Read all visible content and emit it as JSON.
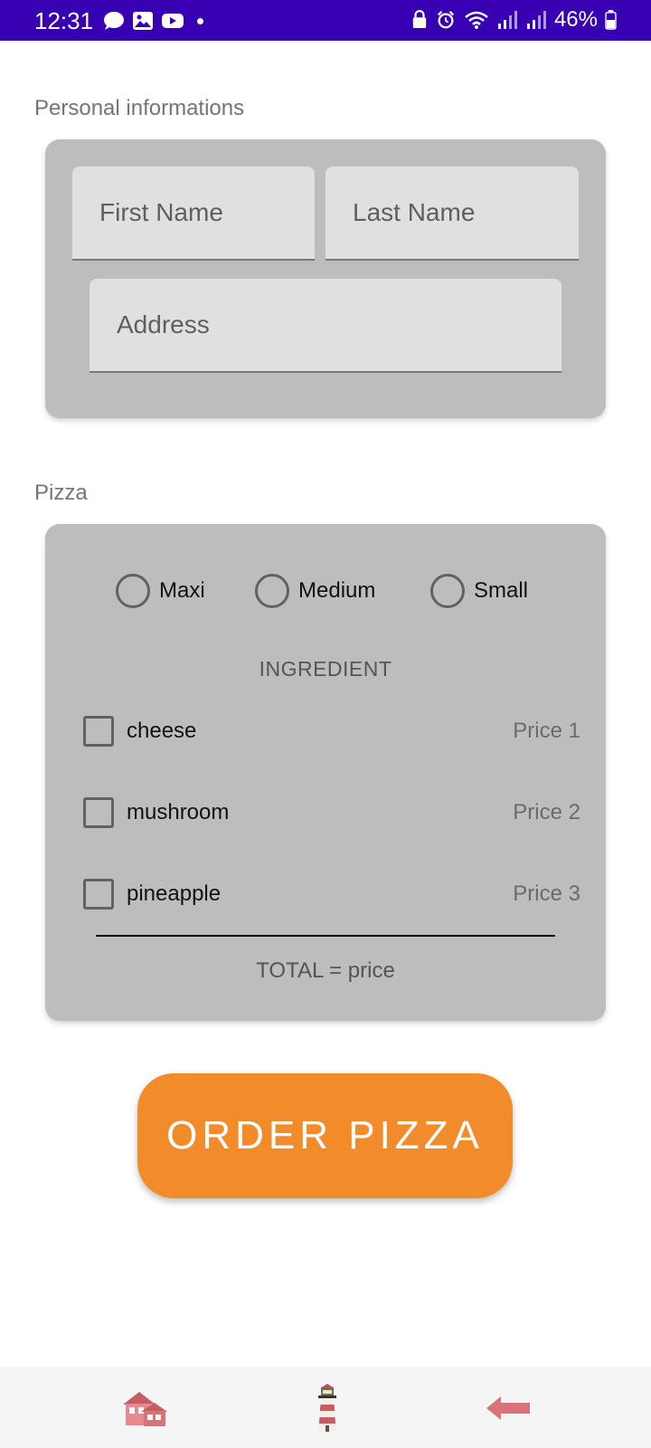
{
  "status_bar": {
    "time": "12:31",
    "battery_percent": "46%",
    "icons_left": [
      "message-icon",
      "image-icon",
      "youtube-icon",
      "dot"
    ],
    "icons_right": [
      "lock-icon",
      "alarm-icon",
      "wifi-icon",
      "signal-icon",
      "signal-icon",
      "battery-icon"
    ]
  },
  "personal": {
    "label": "Personal informations",
    "first_name": {
      "placeholder": "First Name",
      "value": ""
    },
    "last_name": {
      "placeholder": "Last Name",
      "value": ""
    },
    "address": {
      "placeholder": "Address",
      "value": ""
    }
  },
  "pizza": {
    "label": "Pizza",
    "sizes": [
      "Maxi",
      "Medium",
      "Small"
    ],
    "ingredient_title": "INGREDIENT",
    "ingredients": [
      {
        "name": "cheese",
        "price": "Price 1"
      },
      {
        "name": "mushroom",
        "price": "Price 2"
      },
      {
        "name": "pineapple",
        "price": "Price 3"
      }
    ],
    "total": "TOTAL = price"
  },
  "order_button": {
    "label": "ORDER PIZZA"
  },
  "bottom_nav": [
    "home-icon",
    "lighthouse-icon",
    "back-arrow-icon"
  ],
  "colors": {
    "status_bar": "#3700b3",
    "card": "#bdbdbd",
    "field": "#e0e0e0",
    "order_button": "#f28c2a",
    "nav_icon": "#d9737a"
  }
}
